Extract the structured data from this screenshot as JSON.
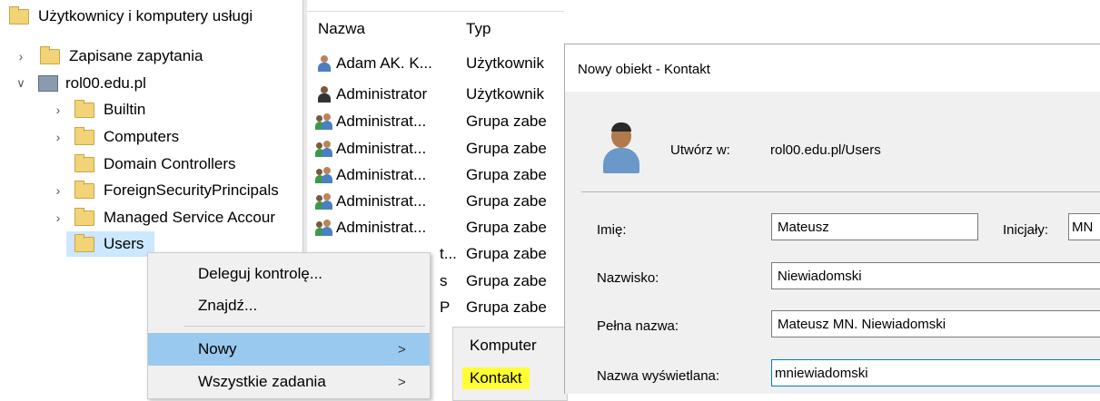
{
  "tree": {
    "root": "Użytkownicy i komputery usługi",
    "items": [
      {
        "label": "Zapisane zapytania",
        "chevron": "chevron-right"
      },
      {
        "label": "rol00.edu.pl",
        "chevron": "chevron-down"
      },
      {
        "label": "Builtin",
        "chevron": "chevron-right"
      },
      {
        "label": "Computers",
        "chevron": "chevron-right"
      },
      {
        "label": "Domain Controllers",
        "chevron": ""
      },
      {
        "label": "ForeignSecurityPrincipals",
        "chevron": "chevron-right"
      },
      {
        "label": "Managed Service Accour",
        "chevron": "chevron-right"
      },
      {
        "label": "Users",
        "chevron": ""
      }
    ]
  },
  "list": {
    "columns": [
      "Nazwa",
      "Typ"
    ],
    "rows": [
      {
        "name": "Adam AK. K...",
        "type": "Użytkownik",
        "icon": "user-icon"
      },
      {
        "name": "Administrator",
        "type": "Użytkownik",
        "icon": "user-icon"
      },
      {
        "name": "Administrat...",
        "type": "Grupa zabe",
        "icon": "group-icon"
      },
      {
        "name": "Administrat...",
        "type": "Grupa zabe",
        "icon": "group-icon"
      },
      {
        "name": "Administrat...",
        "type": "Grupa zabe",
        "icon": "group-icon"
      },
      {
        "name": "Administrat...",
        "type": "Grupa zabe",
        "icon": "group-icon"
      },
      {
        "name": "Administrat...",
        "type": "Grupa zabe",
        "icon": "group-icon"
      },
      {
        "name": "t...",
        "type": "Grupa zabe",
        "icon": ""
      },
      {
        "name": "s",
        "type": "Grupa zabe",
        "icon": ""
      },
      {
        "name": "P",
        "type": "Grupa zabe",
        "icon": ""
      }
    ]
  },
  "context_menu": {
    "items": [
      {
        "label": "Deleguj kontrolę...",
        "submenu": false
      },
      {
        "label": "Znajdź...",
        "submenu": false
      },
      {
        "label": "Nowy",
        "submenu": true
      },
      {
        "label": "Wszystkie zadania",
        "submenu": true
      }
    ],
    "arrow": ">"
  },
  "submenu": {
    "items": [
      "Komputer",
      "Kontakt"
    ]
  },
  "dialog": {
    "title": "Nowy obiekt - Kontakt",
    "create_in_label": "Utwórz w:",
    "create_in_value": "rol00.edu.pl/Users",
    "fields": {
      "first_name": {
        "label": "Imię:",
        "value": "Mateusz"
      },
      "initials": {
        "label": "Inicjały:",
        "value": "MN"
      },
      "last_name": {
        "label": "Nazwisko:",
        "value": "Niewiadomski"
      },
      "full_name": {
        "label": "Pełna nazwa:",
        "value": "Mateusz MN. Niewiadomski"
      },
      "display_name": {
        "label": "Nazwa wyświetlana:",
        "value": "mniewiadomski"
      }
    }
  },
  "colors": {
    "menu_highlight": "#99c9ef",
    "kontakt_highlight": "#ffff33",
    "selection": "#cce8ff"
  }
}
